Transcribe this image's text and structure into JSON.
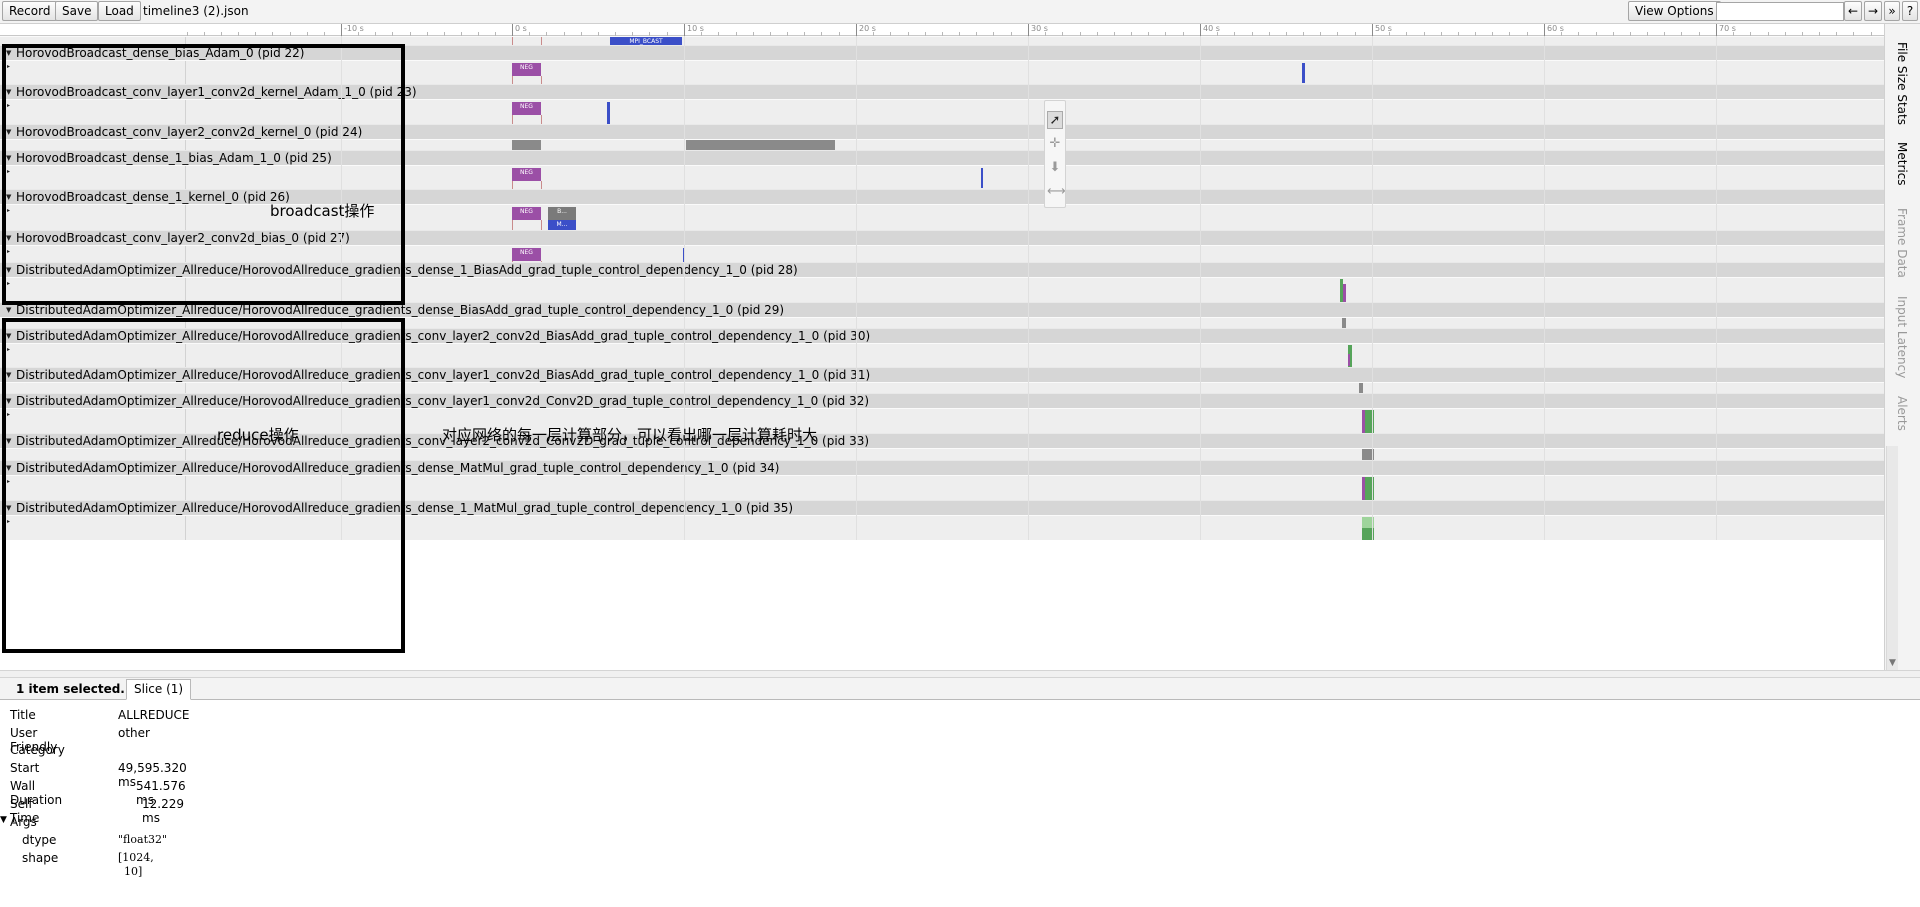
{
  "toolbar": {
    "record_label": "Record",
    "save_label": "Save",
    "load_label": "Load",
    "file_title": "timeline3 (2).json",
    "view_options_label": "View Options",
    "search_value": "",
    "prev_label": "←",
    "next_label": "→",
    "more_label": "»",
    "help_label": "?"
  },
  "ruler": {
    "ticks": [
      "-10 s",
      "0 s",
      "10 s",
      "20 s",
      "30 s",
      "40 s",
      "50 s",
      "60 s",
      "70 s"
    ]
  },
  "processes": [
    {
      "title": "HorovodBroadcast_dense_bias_Adam_0 (pid 22)"
    },
    {
      "title": "HorovodBroadcast_conv_layer1_conv2d_kernel_Adam_1_0 (pid 23)"
    },
    {
      "title": "HorovodBroadcast_conv_layer2_conv2d_kernel_0 (pid 24)"
    },
    {
      "title": "HorovodBroadcast_dense_1_bias_Adam_1_0 (pid 25)"
    },
    {
      "title": "HorovodBroadcast_dense_1_kernel_0 (pid 26)"
    },
    {
      "title": "HorovodBroadcast_conv_layer2_conv2d_bias_0 (pid 27)"
    },
    {
      "title": "DistributedAdamOptimizer_Allreduce/HorovodAllreduce_gradients_dense_1_BiasAdd_grad_tuple_control_dependency_1_0 (pid 28)"
    },
    {
      "title": "DistributedAdamOptimizer_Allreduce/HorovodAllreduce_gradients_dense_BiasAdd_grad_tuple_control_dependency_1_0 (pid 29)"
    },
    {
      "title": "DistributedAdamOptimizer_Allreduce/HorovodAllreduce_gradients_conv_layer2_conv2d_BiasAdd_grad_tuple_control_dependency_1_0 (pid 30)"
    },
    {
      "title": "DistributedAdamOptimizer_Allreduce/HorovodAllreduce_gradients_conv_layer1_conv2d_BiasAdd_grad_tuple_control_dependency_1_0 (pid 31)"
    },
    {
      "title": "DistributedAdamOptimizer_Allreduce/HorovodAllreduce_gradients_conv_layer1_conv2d_Conv2D_grad_tuple_control_dependency_1_0 (pid 32)"
    },
    {
      "title": "DistributedAdamOptimizer_Allreduce/HorovodAllreduce_gradients_conv_layer2_conv2d_Conv2D_grad_tuple_control_dependency_1_0 (pid 33)"
    },
    {
      "title": "DistributedAdamOptimizer_Allreduce/HorovodAllreduce_gradients_dense_MatMul_grad_tuple_control_dependency_1_0 (pid 34)"
    },
    {
      "title": "DistributedAdamOptimizer_Allreduce/HorovodAllreduce_gradients_dense_1_MatMul_grad_tuple_control_dependency_1_0 (pid 35)"
    }
  ],
  "slices": {
    "top_partial": "MPI_BCAST",
    "neg": "NEG",
    "b_short": "B...",
    "m_short": "M..."
  },
  "annotations": {
    "broadcast": "broadcast操作",
    "reduce": "reduce操作",
    "compute": "对应网络的每一层计算部分，可以看出哪一层计算耗时大"
  },
  "side_tabs": [
    "File Size Stats",
    "Metrics",
    "Frame Data",
    "Input Latency",
    "Alerts"
  ],
  "analysis": {
    "selected_count": "1 item selected.",
    "tab_label": "Slice (1)",
    "title_label": "Title",
    "title_value": "ALLREDUCE",
    "category_label_1": "User Friendly",
    "category_label_2": "Category",
    "category_value": "other",
    "start_label": "Start",
    "start_value": "49,595.320 ms",
    "wall_label": "Wall Duration",
    "wall_value": "541.576 ms",
    "self_label": "Self Time",
    "self_value": "12.229 ms",
    "args_label": "Args",
    "dtype_label": "dtype",
    "dtype_value": "\"float32\"",
    "shape_label": "shape",
    "shape_value_1": "[1024,",
    "shape_value_2": "10]"
  },
  "colors": {
    "neg": "#9b4fa6",
    "bcast": "#3b4fc8",
    "gray": "#8a8a8a",
    "green": "#56a45a",
    "annotation": "#000000"
  }
}
